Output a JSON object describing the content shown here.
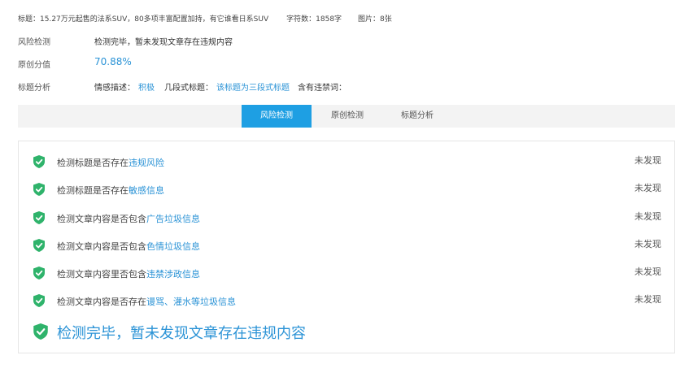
{
  "meta": {
    "title_text": "标题：15.27万元起售的法系SUV，80多项丰富配置加持，有它谁看日系SUV",
    "char_count_text": "字符数：1858字",
    "image_count_text": "图片：8张"
  },
  "risk": {
    "label": "风险检测",
    "value": "检测完毕，暂未发现文章存在违规内容"
  },
  "originality": {
    "label": "原创分值",
    "value": "70.88%"
  },
  "title_analysis": {
    "label": "标题分析",
    "emotion_label": "情感描述：",
    "emotion_value": "积极",
    "segments_label": "几段式标题：",
    "segments_value": "该标题为三段式标题",
    "banned_label": "含有违禁词："
  },
  "tabs": [
    {
      "label": "风险检测",
      "active": true
    },
    {
      "label": "原创检测",
      "active": false
    },
    {
      "label": "标题分析",
      "active": false
    }
  ],
  "checks": [
    {
      "prefix": "检测标题是否存在",
      "highlight": "违规风险",
      "status": "未发现"
    },
    {
      "prefix": "检测标题是否存在",
      "highlight": "敏感信息",
      "status": "未发现"
    },
    {
      "prefix": "检测文章内容是否包含",
      "highlight": "广告垃圾信息",
      "status": "未发现"
    },
    {
      "prefix": "检测文章内容是否包含",
      "highlight": "色情垃圾信息",
      "status": "未发现"
    },
    {
      "prefix": "检测文章内容里否包含",
      "highlight": "违禁涉政信息",
      "status": "未发现"
    },
    {
      "prefix": "检测文章内容是否存在",
      "highlight": "谩骂、灌水等垃圾信息",
      "status": "未发现"
    }
  ],
  "final_message": "检测完毕，暂未发现文章存在违规内容",
  "colors": {
    "accent": "#1e9fe3",
    "link": "#2b93d6",
    "shield_green": "#2fb36b"
  },
  "icons": {
    "check": "green-shield-check-icon"
  }
}
